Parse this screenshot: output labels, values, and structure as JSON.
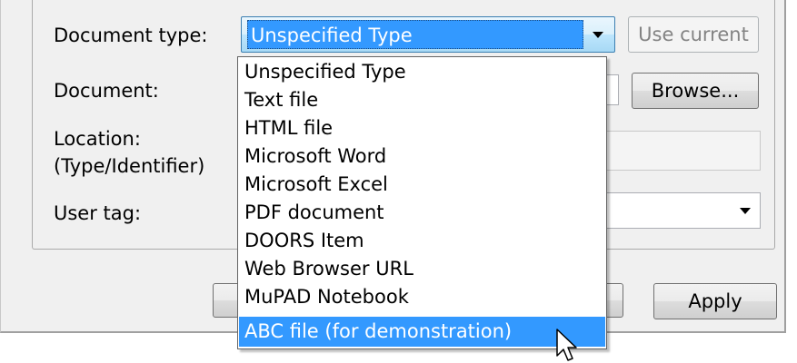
{
  "form": {
    "document_type_label": "Document type:",
    "document_label": "Document:",
    "location_label_line1": "Location:",
    "location_label_line2": "(Type/Identifier)",
    "user_tag_label": "User tag:"
  },
  "document_type_combo": {
    "value": "Unspecified Type",
    "options": [
      "Unspecified Type",
      "Text file",
      "HTML file",
      "Microsoft Word",
      "Microsoft Excel",
      "PDF document",
      "DOORS Item",
      "Web Browser URL",
      "MuPAD Notebook",
      "ABC  file (for demonstration)"
    ],
    "highlighted_option": "ABC  file (for demonstration)"
  },
  "buttons": {
    "use_current": "Use current",
    "browse": "Browse...",
    "apply": "Apply"
  },
  "icons": {
    "combo_arrow": "chevron-down-icon",
    "user_tag_arrow": "chevron-down-icon",
    "cursor": "mouse-pointer-icon"
  },
  "colors": {
    "selection": "#3399ff",
    "dialog_background": "#f0f0f0"
  }
}
